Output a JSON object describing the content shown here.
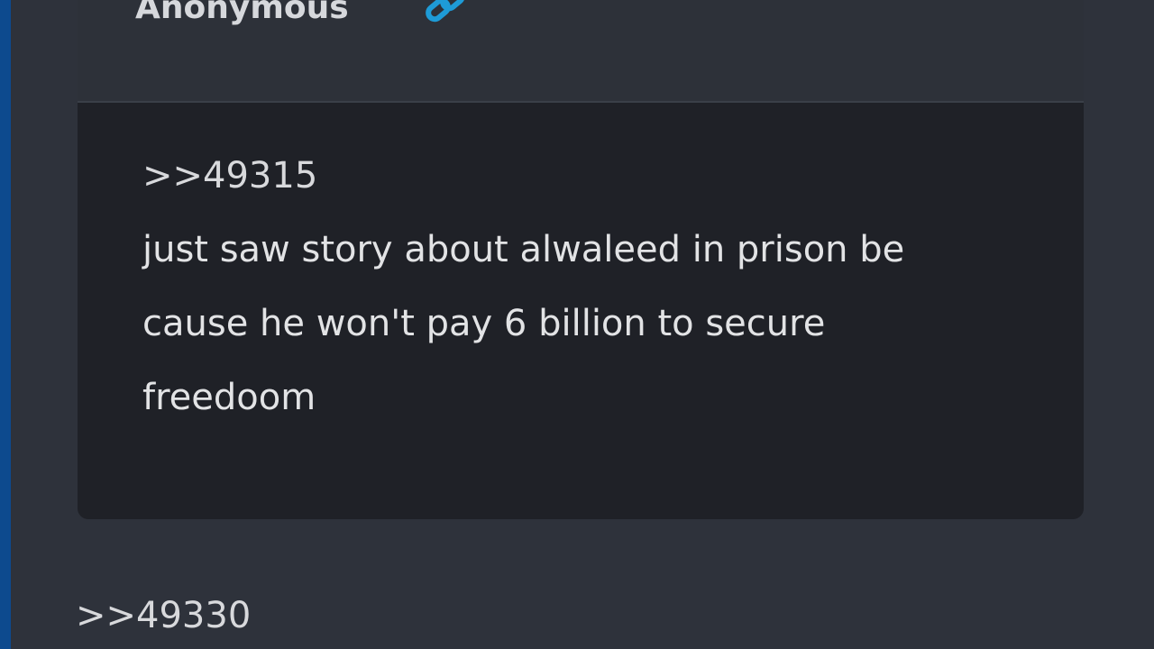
{
  "post": {
    "author": "Anonymous",
    "quote_ref": ">>49315",
    "body_lines": [
      "just saw story about alwaleed in prison be",
      "cause he won't pay 6 billion to secure",
      "freedoom"
    ]
  },
  "next_post": {
    "quote_ref": ">>49330"
  },
  "icons": {
    "link": "link-icon"
  },
  "colors": {
    "accent": "#1e9bd7",
    "left_bar": "#0d4a8e"
  }
}
